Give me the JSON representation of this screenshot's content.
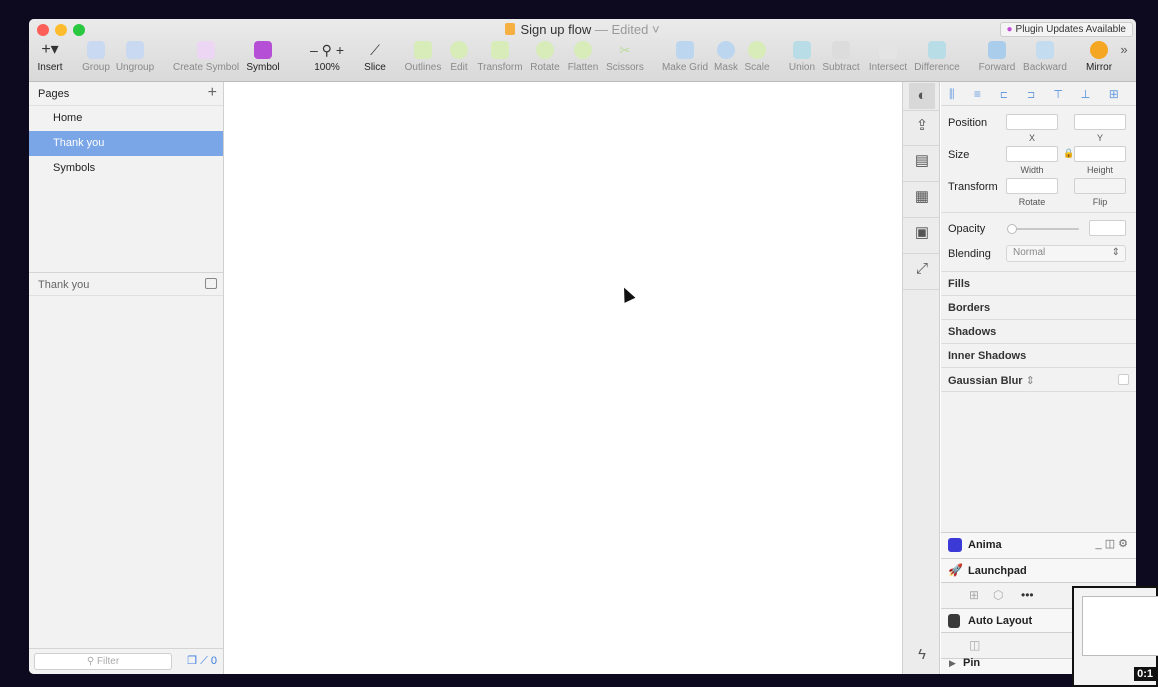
{
  "window": {
    "title": "Sign up flow",
    "title_state": " — Edited ˅",
    "plugin_updates": "Plugin Updates Available"
  },
  "toolbar": {
    "insert": "Insert",
    "group": "Group",
    "ungroup": "Ungroup",
    "create_symbol": "Create Symbol",
    "symbol": "Symbol",
    "zoom_level": "100%",
    "slice": "Slice",
    "outlines": "Outlines",
    "edit": "Edit",
    "transform": "Transform",
    "rotate": "Rotate",
    "flatten": "Flatten",
    "scissors": "Scissors",
    "make_grid": "Make Grid",
    "mask": "Mask",
    "scale": "Scale",
    "union": "Union",
    "subtract": "Subtract",
    "intersect": "Intersect",
    "difference": "Difference",
    "forward": "Forward",
    "backward": "Backward",
    "mirror": "Mirror"
  },
  "pages": {
    "header": "Pages",
    "items": [
      {
        "label": "Home",
        "selected": false
      },
      {
        "label": "Thank you",
        "selected": true
      },
      {
        "label": "Symbols",
        "selected": false
      }
    ],
    "current_page": "Thank you",
    "filter_placeholder": "Filter",
    "layer_count": "0"
  },
  "inspector": {
    "position": "Position",
    "x": "X",
    "y": "Y",
    "size": "Size",
    "width": "Width",
    "height": "Height",
    "transform": "Transform",
    "rotate": "Rotate",
    "flip": "Flip",
    "opacity": "Opacity",
    "blending": "Blending",
    "blending_value": "Normal",
    "fills": "Fills",
    "borders": "Borders",
    "shadows": "Shadows",
    "inner_shadows": "Inner Shadows",
    "gaussian_blur": "Gaussian Blur"
  },
  "plugins": {
    "anima": "Anima",
    "launchpad": "Launchpad",
    "auto_layout": "Auto Layout",
    "pin": "Pin"
  },
  "video": {
    "timestamp": "0:1"
  },
  "colors": {
    "selected_page": "#7aa5e6",
    "symbol_accent": "#b44fd6",
    "align_icons": "#6a9de0"
  }
}
